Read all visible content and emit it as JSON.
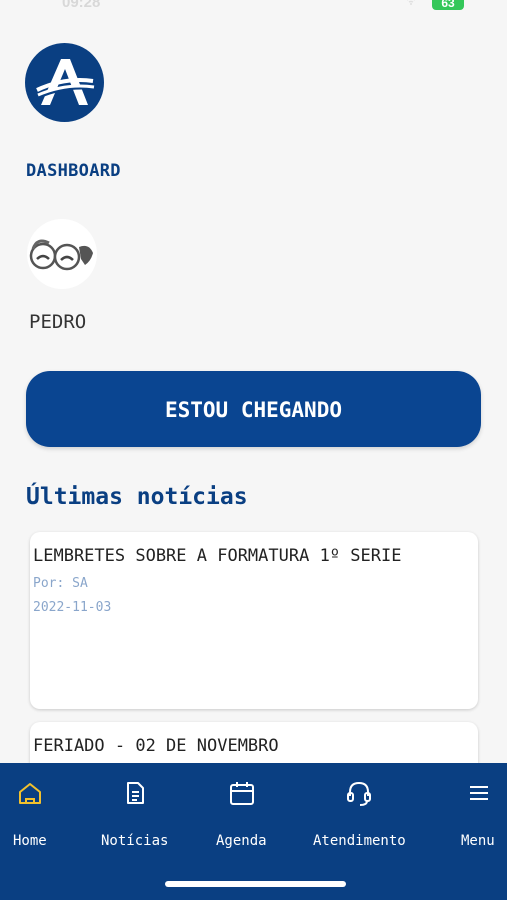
{
  "status_bar": {
    "time": "09:28",
    "battery": "63"
  },
  "app": {
    "section_label": "DASHBOARD"
  },
  "user": {
    "name": "PEDRO"
  },
  "cta": {
    "label": "ESTOU CHEGANDO"
  },
  "news": {
    "heading": "Últimas notícias",
    "items": [
      {
        "title": "LEMBRETES SOBRE A FORMATURA 1º SERIE",
        "author": "Por: SA",
        "date": "2022-11-03"
      },
      {
        "title": "FERIADO - 02 DE NOVEMBRO",
        "author": "",
        "date": ""
      }
    ]
  },
  "nav": {
    "items": [
      {
        "label": "Home",
        "icon": "home-icon",
        "active": true
      },
      {
        "label": "Notícias",
        "icon": "document-icon",
        "active": false
      },
      {
        "label": "Agenda",
        "icon": "calendar-icon",
        "active": false
      },
      {
        "label": "Atendimento",
        "icon": "headset-icon",
        "active": false
      },
      {
        "label": "Menu",
        "icon": "hamburger-menu-icon",
        "active": false
      }
    ]
  },
  "colors": {
    "brand": "#0a3f82",
    "button": "#0a4591",
    "active_icon": "#f2c12e",
    "meta_text": "#8aa6cb",
    "battery": "#34c759"
  }
}
